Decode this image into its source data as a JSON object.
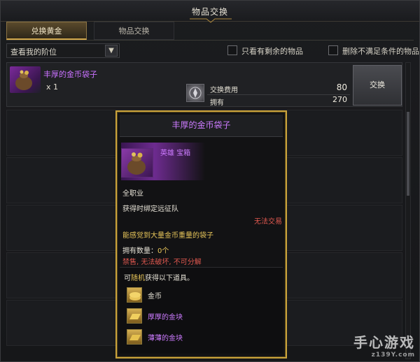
{
  "window": {
    "title": "物品交换"
  },
  "tabs": [
    {
      "label": "兑换黄金",
      "active": true
    },
    {
      "label": "物品交换",
      "active": false
    }
  ],
  "filters": {
    "dropdown_value": "查看我的阶位",
    "checkboxes": [
      {
        "label": "只看有剩余的物品",
        "checked": false
      },
      {
        "label": "删除不满足条件的物品",
        "checked": false
      }
    ]
  },
  "offer": {
    "item_name": "丰厚的金币袋子",
    "quantity": "x 1",
    "cost_label": "交换费用",
    "cost_value": "80",
    "owned_label": "拥有",
    "owned_value": "270",
    "exchange_button": "交换"
  },
  "tooltip": {
    "name": "丰厚的金币袋子",
    "grade": "英雄 宝箱",
    "class": "全职业",
    "binding": "获得时绑定远征队",
    "trade": "无法交易",
    "description": "能感觉到大量金币重量的袋子",
    "owned_count_label": "拥有数量：",
    "owned_count_value": "0个",
    "restrictions": "禁售, 无法破坏, 不可分解",
    "random_prefix": "可",
    "random_word": "随机",
    "random_suffix": "获得以下道具。",
    "rewards": [
      {
        "name": "金币",
        "color": "#e6e2d6",
        "icon": "gold-coin-icon"
      },
      {
        "name": "厚厚的金块",
        "color": "#cc7bff",
        "icon": "gold-bar-icon"
      },
      {
        "name": "薄薄的金块",
        "color": "#cc7bff",
        "icon": "gold-bar-icon"
      }
    ]
  },
  "watermark": {
    "text": "手心游戏",
    "sub": "z139Y.com"
  },
  "colors": {
    "accent_gold": "#c9a23b",
    "epic_purple": "#cc7bff",
    "warning_red": "#e0584f"
  }
}
